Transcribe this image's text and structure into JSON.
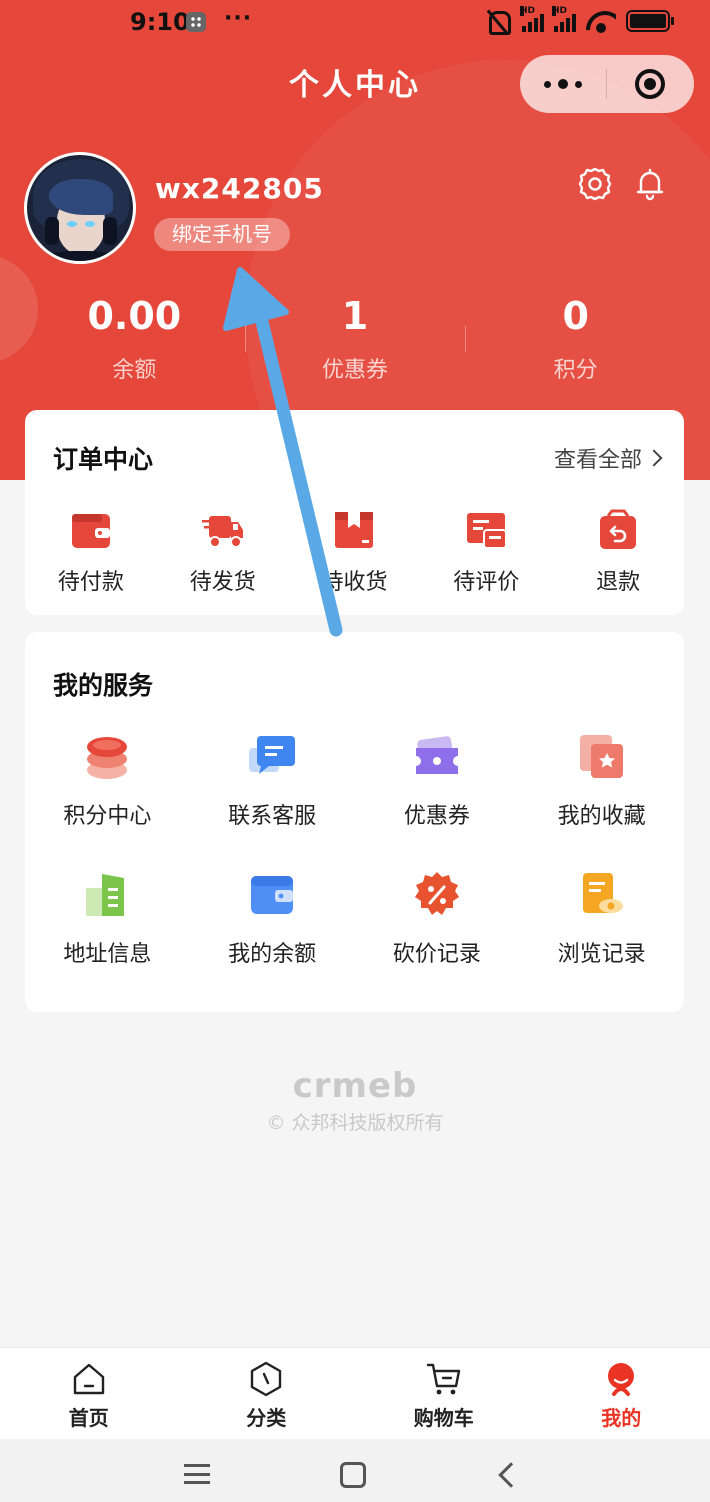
{
  "status_bar": {
    "time": "9:10",
    "dots": "···",
    "signal1_label": "HD",
    "signal2_label": "HD"
  },
  "nav": {
    "title": "个人中心"
  },
  "profile": {
    "username": "wx242805",
    "bind_phone_label": "绑定手机号"
  },
  "stats": [
    {
      "value": "0.00",
      "label": "余额"
    },
    {
      "value": "1",
      "label": "优惠券"
    },
    {
      "value": "0",
      "label": "积分"
    }
  ],
  "orders": {
    "title": "订单中心",
    "view_all": "查看全部",
    "items": [
      {
        "label": "待付款",
        "icon": "wallet-icon"
      },
      {
        "label": "待发货",
        "icon": "truck-icon"
      },
      {
        "label": "待收货",
        "icon": "box-icon"
      },
      {
        "label": "待评价",
        "icon": "review-icon"
      },
      {
        "label": "退款",
        "icon": "refund-icon"
      }
    ]
  },
  "services": {
    "title": "我的服务",
    "items": [
      {
        "label": "积分中心",
        "icon": "coins-icon"
      },
      {
        "label": "联系客服",
        "icon": "chat-icon"
      },
      {
        "label": "优惠券",
        "icon": "ticket-icon"
      },
      {
        "label": "我的收藏",
        "icon": "favorite-icon"
      },
      {
        "label": "地址信息",
        "icon": "address-icon"
      },
      {
        "label": "我的余额",
        "icon": "wallet-balance-icon"
      },
      {
        "label": "砍价记录",
        "icon": "discount-icon"
      },
      {
        "label": "浏览记录",
        "icon": "history-icon"
      }
    ]
  },
  "watermark": {
    "logo": "crmeb",
    "copyright": "© 众邦科技版权所有"
  },
  "tabbar": [
    {
      "label": "首页",
      "icon": "home-icon",
      "active": false
    },
    {
      "label": "分类",
      "icon": "category-icon",
      "active": false
    },
    {
      "label": "购物车",
      "icon": "cart-icon",
      "active": false
    },
    {
      "label": "我的",
      "icon": "profile-icon",
      "active": true
    }
  ],
  "colors": {
    "brand": "#e5473a",
    "active_tab": "#e93323",
    "annotation_arrow": "#5aa9e6"
  }
}
